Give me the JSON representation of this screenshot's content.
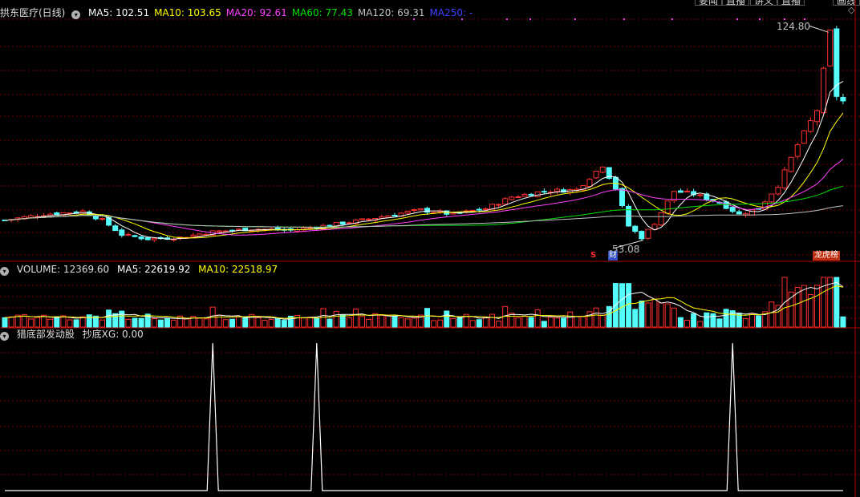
{
  "colors": {
    "up": "#ff3030",
    "down": "#54fcfc",
    "grid": "#7a0000",
    "border": "#b00000",
    "ma5": "#ffffff",
    "ma10": "#ffff00",
    "ma20": "#ff40ff",
    "ma60": "#00e000",
    "ma120": "#c0c0c0",
    "ma250": "#4040ff",
    "white": "#ffffff",
    "label": "#c0c0c0"
  },
  "top_buttons": [
    "要闻",
    "直播",
    "讲义",
    "直播",
    "画线"
  ],
  "price_panel": {
    "stock_label": "拱东医疗(日线)",
    "indicators": [
      {
        "name": "MA5",
        "value": "102.51",
        "color": "#ffffff"
      },
      {
        "name": "MA10",
        "value": "103.65",
        "color": "#ffff00"
      },
      {
        "name": "MA20",
        "value": "92.61",
        "color": "#ff40ff"
      },
      {
        "name": "MA60",
        "value": "77.43",
        "color": "#00e000"
      },
      {
        "name": "MA120",
        "value": "69.31",
        "color": "#c0c0c0"
      },
      {
        "name": "MA250",
        "value": "-",
        "color": "#4040ff"
      }
    ],
    "high_label": "124.80",
    "low_label": "53.08",
    "marker_s": "S",
    "marker_cai": "财",
    "marker_lhb": "龙虎榜"
  },
  "volume_panel": {
    "label": "VOLUME: 12369.60",
    "ma5": "MA5: 22619.92",
    "ma10": "MA10: 22518.97"
  },
  "indicator_panel": {
    "title": "猎底部发动股",
    "value": "抄底XG: 0.00"
  },
  "chart_data": [
    {
      "type": "candlestick",
      "title": "拱东医疗(日线)",
      "high": 124.8,
      "low": 53.08,
      "grid": true,
      "series": [
        {
          "name": "MA5",
          "last": 102.51
        },
        {
          "name": "MA10",
          "last": 103.65
        },
        {
          "name": "MA20",
          "last": 92.61
        },
        {
          "name": "MA60",
          "last": 77.43
        },
        {
          "name": "MA120",
          "last": 69.31
        }
      ]
    },
    {
      "type": "bar",
      "title": "VOLUME",
      "last": 12369.6,
      "series": [
        {
          "name": "MA5",
          "last": 22619.92
        },
        {
          "name": "MA10",
          "last": 22518.97
        }
      ]
    },
    {
      "type": "line",
      "title": "猎底部发动股",
      "series": [
        {
          "name": "抄底XG",
          "last": 0.0,
          "spike_days": [
            32,
            48,
            112
          ]
        }
      ]
    }
  ]
}
